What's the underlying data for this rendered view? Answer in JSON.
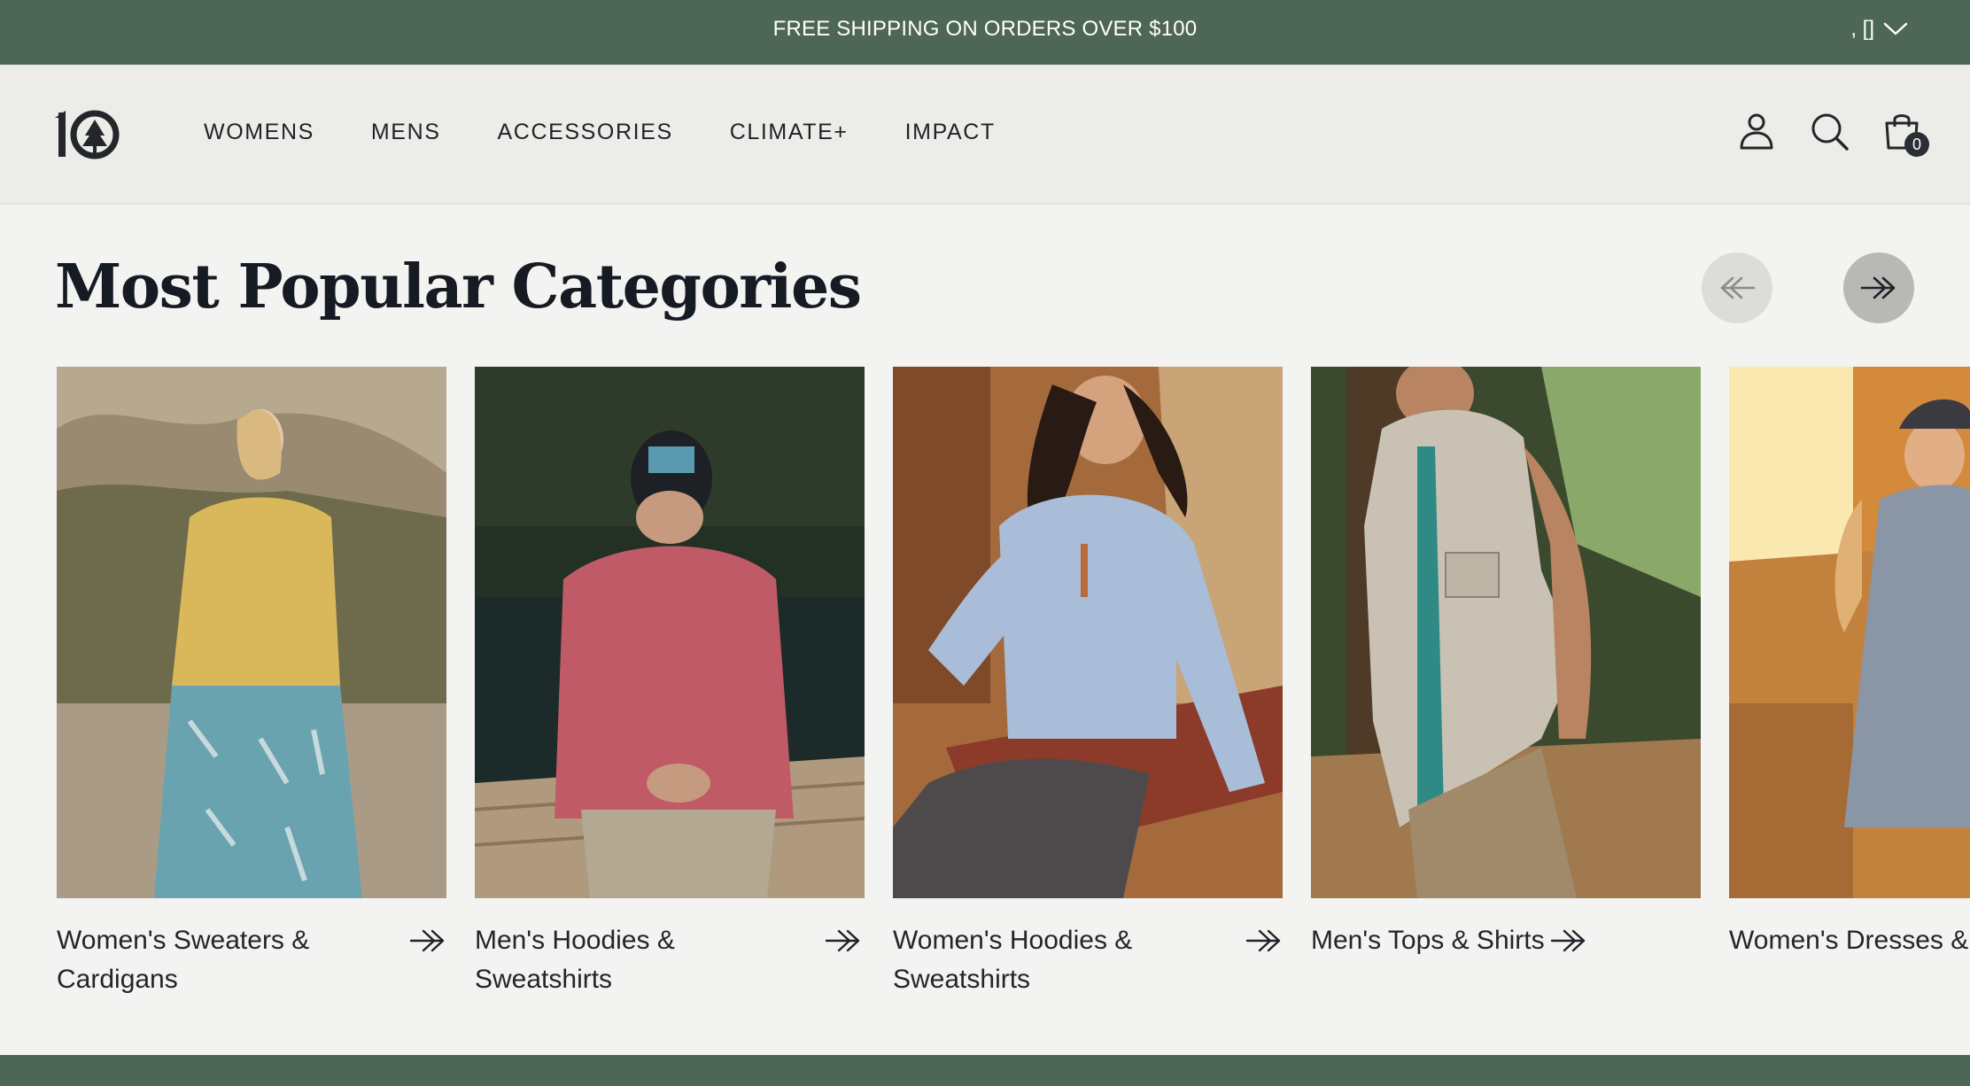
{
  "announcement": {
    "text": "FREE SHIPPING ON ORDERS OVER $100",
    "locale_text": ", []"
  },
  "header": {
    "logo_alt": "tentree logo",
    "nav": [
      {
        "label": "WOMENS"
      },
      {
        "label": "MENS"
      },
      {
        "label": "ACCESSORIES"
      },
      {
        "label": "CLIMATE+"
      },
      {
        "label": "IMPACT"
      }
    ],
    "icons": [
      "account-icon",
      "search-icon",
      "cart-icon"
    ],
    "cart_count": "0"
  },
  "section": {
    "title": "Most Popular Categories",
    "prev_icon": "arrow-left-icon",
    "next_icon": "arrow-right-icon"
  },
  "categories": [
    {
      "label": "Women's Sweaters & Cardigans",
      "image": "woman in yellow sweater and blue floral skirt on hillside"
    },
    {
      "label": "Men's Hoodies & Sweatshirts",
      "image": "man in red hoodie and black cap on dock by lake"
    },
    {
      "label": "Women's Hoodies & Sweatshirts",
      "image": "woman in light blue half-zip sweatshirt sitting on bench"
    },
    {
      "label": "Men's Tops & Shirts",
      "image": "man in grey short-sleeve button shirt in forest"
    },
    {
      "label": "Women's Dresses & R",
      "image": "woman in grey shirt dress with cap at sunset"
    }
  ],
  "colors": {
    "brand_green": "#4e6655",
    "header_bg": "#ececE8",
    "page_bg": "#f3f3f1",
    "text": "#1f2228"
  }
}
